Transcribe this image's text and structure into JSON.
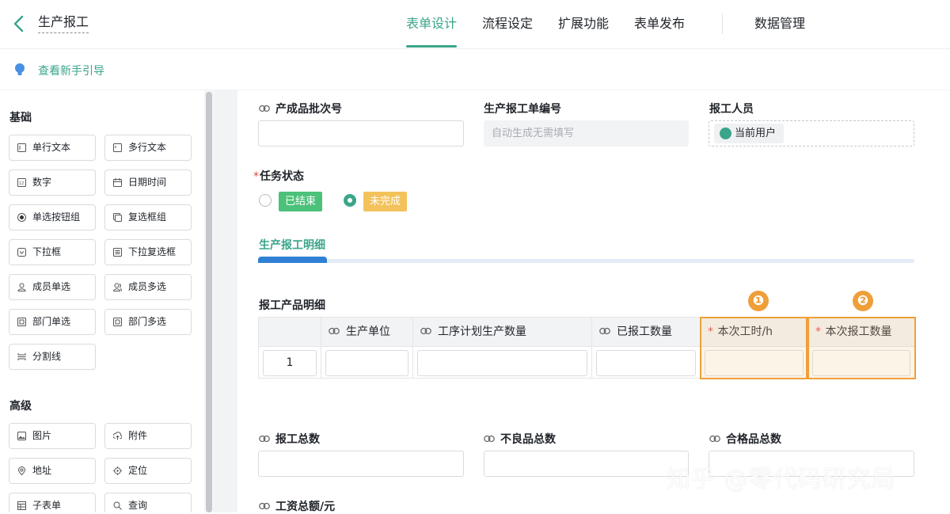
{
  "header": {
    "back_icon": "chevron-left-icon",
    "app_title": "生产报工",
    "tabs": [
      "表单设计",
      "流程设定",
      "扩展功能",
      "表单发布"
    ],
    "active_tab": "表单设计",
    "data_manage": "数据管理"
  },
  "guide": {
    "icon": "bulb-icon",
    "label": "查看新手引导"
  },
  "sidebar": {
    "basic_title": "基础",
    "basic": [
      {
        "label": "单行文本",
        "icon": "single-line-text-icon"
      },
      {
        "label": "多行文本",
        "icon": "multi-line-text-icon"
      },
      {
        "label": "数字",
        "icon": "number-icon"
      },
      {
        "label": "日期时间",
        "icon": "calendar-icon"
      },
      {
        "label": "单选按钮组",
        "icon": "radio-icon"
      },
      {
        "label": "复选框组",
        "icon": "checkbox-group-icon"
      },
      {
        "label": "下拉框",
        "icon": "dropdown-icon"
      },
      {
        "label": "下拉复选框",
        "icon": "dropdown-multi-icon"
      },
      {
        "label": "成员单选",
        "icon": "member-icon"
      },
      {
        "label": "成员多选",
        "icon": "members-icon"
      },
      {
        "label": "部门单选",
        "icon": "department-icon"
      },
      {
        "label": "部门多选",
        "icon": "departments-icon"
      },
      {
        "label": "分割线",
        "icon": "divider-icon"
      }
    ],
    "advanced_title": "高级",
    "advanced": [
      {
        "label": "图片",
        "icon": "image-icon"
      },
      {
        "label": "附件",
        "icon": "upload-icon"
      },
      {
        "label": "地址",
        "icon": "location-pin-icon"
      },
      {
        "label": "定位",
        "icon": "target-icon"
      },
      {
        "label": "子表单",
        "icon": "subform-icon"
      },
      {
        "label": "查询",
        "icon": "query-icon"
      }
    ]
  },
  "form": {
    "batch_no_label": "产成品批次号",
    "report_no_label": "生产报工单编号",
    "report_no_placeholder": "自动生成无需填写",
    "reporter_label": "报工人员",
    "reporter_value": "当前用户",
    "task_status_label": "任务状态",
    "status_options": [
      {
        "label": "已结束",
        "color": "#4cc17a",
        "selected": false
      },
      {
        "label": "未完成",
        "color": "#f3c25b",
        "selected": true
      }
    ],
    "subform_tab": "生产报工明细",
    "table_title": "报工产品明细",
    "columns": [
      "生产单位",
      "工序计划生产数量",
      "已报工数量",
      "本次工时/h",
      "本次报工数量"
    ],
    "row_index": "1",
    "badges": [
      "❶",
      "❷"
    ],
    "total_label": "报工总数",
    "defect_label": "不良品总数",
    "qualified_label": "合格品总数",
    "wage_label": "工资总额/元",
    "highlight_color": "#ef9f3a"
  },
  "watermark": "知乎 @零代码研究局"
}
